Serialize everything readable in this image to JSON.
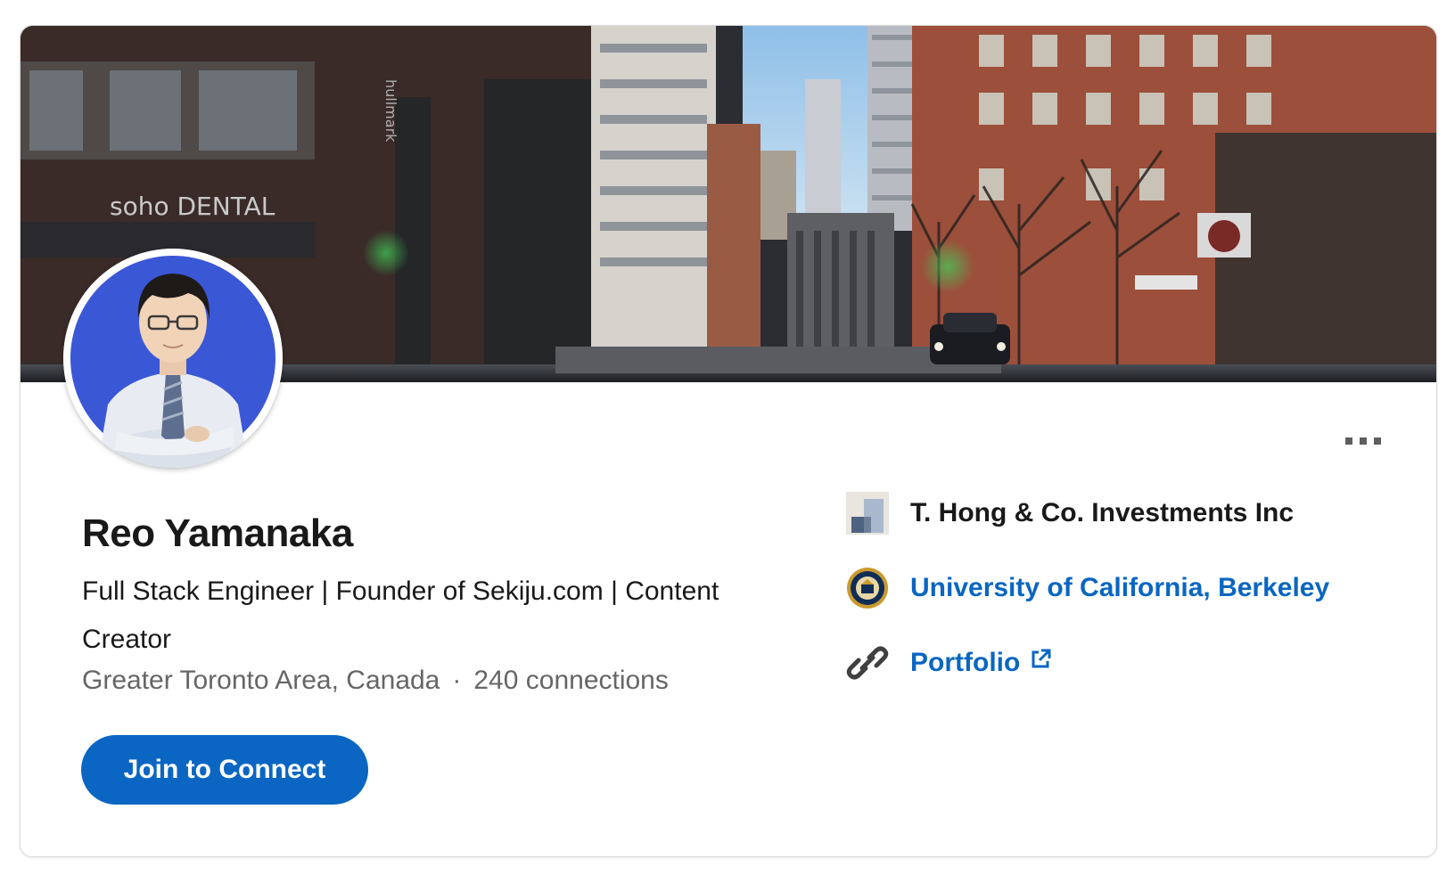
{
  "profile": {
    "name": "Reo Yamanaka",
    "headline": "Full Stack Engineer | Founder of Sekiju.com | Content Creator",
    "location": "Greater Toronto Area, Canada",
    "separator": "·",
    "connections": "240 connections",
    "join_button_label": "Join to Connect"
  },
  "aside": {
    "company": "T. Hong & Co. Investments Inc",
    "school": "University of California, Berkeley",
    "portfolio_label": "Portfolio"
  },
  "cover": {
    "sign_text": "soho DENTAL",
    "vertical_sign": "hullmark"
  },
  "icons": {
    "more": "more-options-icon",
    "company_logo": "company-logo-icon",
    "school_seal": "school-seal-icon",
    "link": "link-icon",
    "external_link": "external-link-icon"
  },
  "colors": {
    "accent": "#0a66c2",
    "text_primary": "#191919",
    "text_secondary": "#666666"
  }
}
